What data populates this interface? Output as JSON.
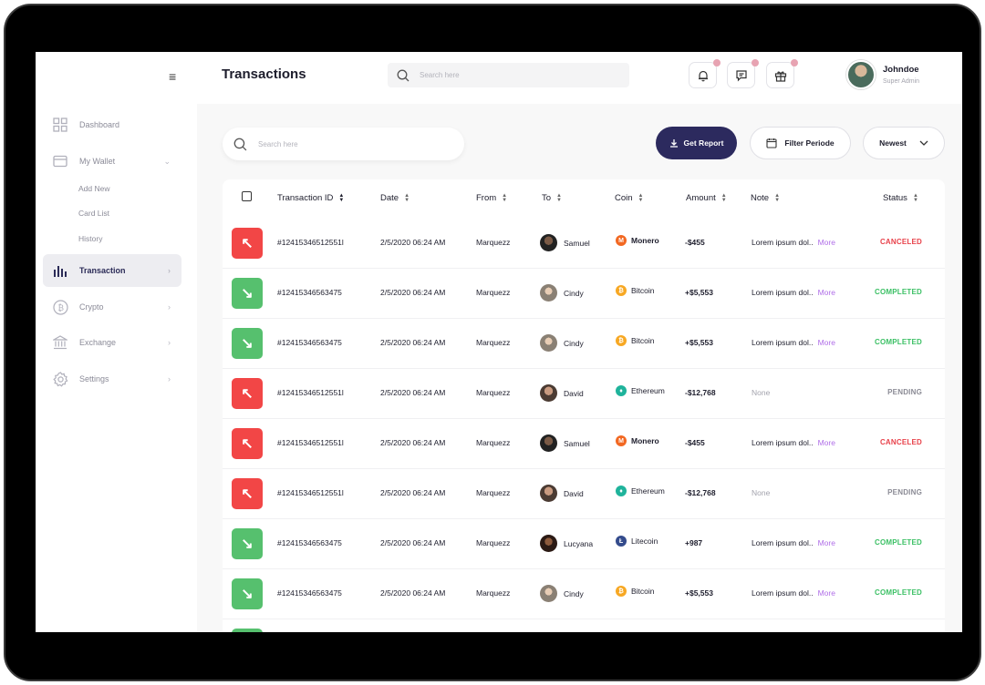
{
  "header": {
    "title": "Transactions",
    "search_placeholder": "Search here",
    "user": {
      "name": "Johndoe",
      "role": "Super Admin"
    }
  },
  "sidebar": {
    "items": [
      {
        "label": "Dashboard",
        "icon": "grid-icon"
      },
      {
        "label": "My Wallet",
        "icon": "wallet-icon",
        "expanded": true,
        "children": [
          "Add New",
          "Card List",
          "History"
        ]
      },
      {
        "label": "Transaction",
        "icon": "bar-chart-icon",
        "active": true
      },
      {
        "label": "Crypto",
        "icon": "bitcoin-icon"
      },
      {
        "label": "Exchange",
        "icon": "bank-icon"
      },
      {
        "label": "Settings",
        "icon": "gear-icon"
      }
    ]
  },
  "toolbar": {
    "search_placeholder": "Search here",
    "get_report": "Get Report",
    "filter_periode": "Filter Periode",
    "sort": "Newest"
  },
  "table": {
    "columns": [
      "Transaction ID",
      "Date",
      "From",
      "To",
      "Coin",
      "Amount",
      "Note",
      "Status"
    ],
    "rows": [
      {
        "direction": "out",
        "id": "#12415346512551l",
        "date": "2/5/2020 06:24 AM",
        "from": "Marquezz",
        "to": "Samuel",
        "coin": "Monero",
        "amount": "-$455",
        "note": "Lorem ipsum dol..",
        "more": "More",
        "status": "CANCELED"
      },
      {
        "direction": "in",
        "id": "#12415346563475",
        "date": "2/5/2020 06:24 AM",
        "from": "Marquezz",
        "to": "Cindy",
        "coin": "Bitcoin",
        "amount": "+$5,553",
        "note": "Lorem ipsum dol..",
        "more": "More",
        "status": "COMPLETED"
      },
      {
        "direction": "in",
        "id": "#12415346563475",
        "date": "2/5/2020 06:24 AM",
        "from": "Marquezz",
        "to": "Cindy",
        "coin": "Bitcoin",
        "amount": "+$5,553",
        "note": "Lorem ipsum dol..",
        "more": "More",
        "status": "COMPLETED"
      },
      {
        "direction": "out",
        "id": "#12415346512551l",
        "date": "2/5/2020 06:24 AM",
        "from": "Marquezz",
        "to": "David",
        "coin": "Ethereum",
        "amount": "-$12,768",
        "note": "None",
        "more": "",
        "status": "PENDING"
      },
      {
        "direction": "out",
        "id": "#12415346512551l",
        "date": "2/5/2020 06:24 AM",
        "from": "Marquezz",
        "to": "Samuel",
        "coin": "Monero",
        "amount": "-$455",
        "note": "Lorem ipsum dol..",
        "more": "More",
        "status": "CANCELED"
      },
      {
        "direction": "out",
        "id": "#12415346512551l",
        "date": "2/5/2020 06:24 AM",
        "from": "Marquezz",
        "to": "David",
        "coin": "Ethereum",
        "amount": "-$12,768",
        "note": "None",
        "more": "",
        "status": "PENDING"
      },
      {
        "direction": "in",
        "id": "#12415346563475",
        "date": "2/5/2020 06:24 AM",
        "from": "Marquezz",
        "to": "Lucyana",
        "coin": "Litecoin",
        "amount": "+987",
        "note": "Lorem ipsum dol..",
        "more": "More",
        "status": "COMPLETED"
      },
      {
        "direction": "in",
        "id": "#12415346563475",
        "date": "2/5/2020 06:24 AM",
        "from": "Marquezz",
        "to": "Cindy",
        "coin": "Bitcoin",
        "amount": "+$5,553",
        "note": "Lorem ipsum dol..",
        "more": "More",
        "status": "COMPLETED"
      }
    ]
  },
  "colors": {
    "primary": "#2c2a5e",
    "canceled": "#e8414a",
    "completed": "#3cc065",
    "pending": "#8b8b95",
    "more_link": "#b06ee8",
    "out": "#f24646",
    "in": "#56c06e",
    "monero": "#f26822",
    "bitcoin": "#f7a823",
    "ethereum": "#1fb39b",
    "litecoin": "#344b8c"
  }
}
